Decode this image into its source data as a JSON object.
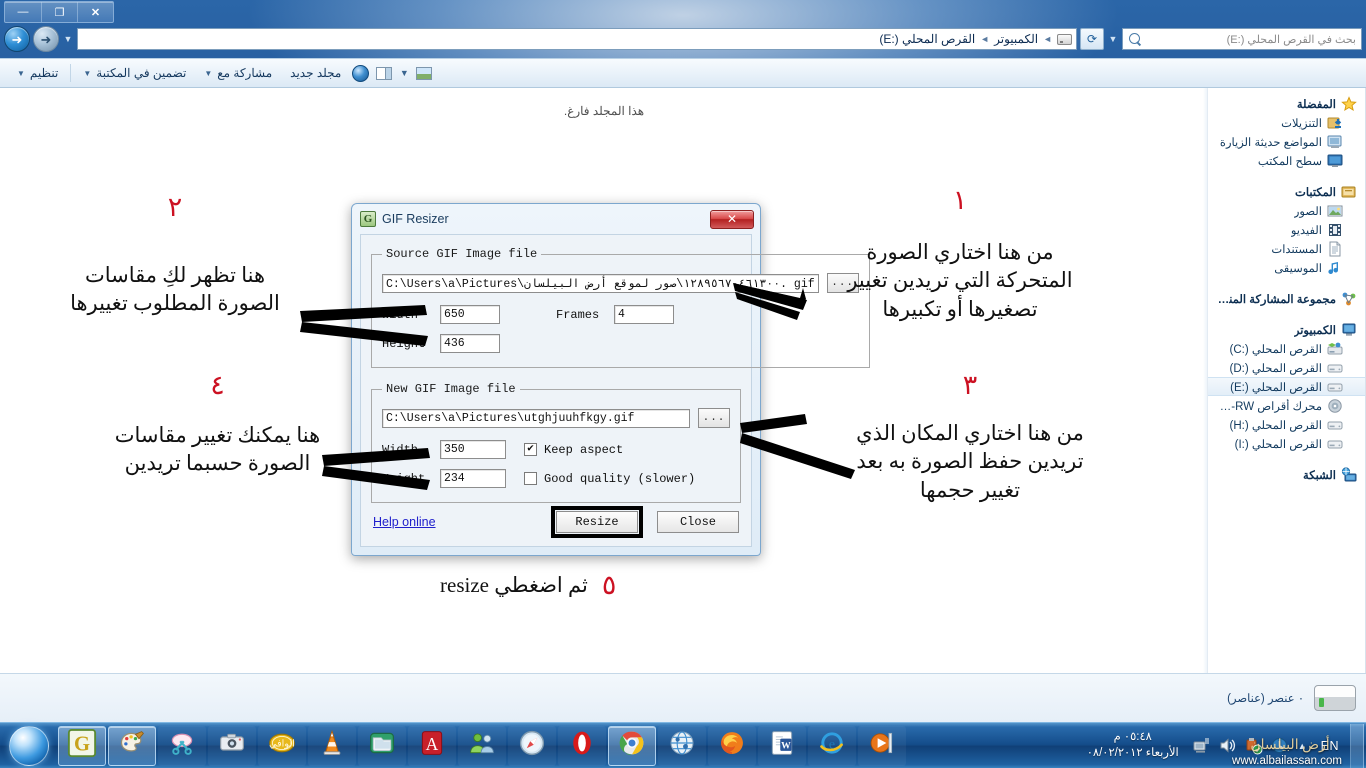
{
  "window": {
    "buttons": {
      "close": "✕",
      "restore": "❐",
      "minimize": "—"
    }
  },
  "address": {
    "back_icon": "back-arrow-icon",
    "forward_icon": "forward-arrow-icon",
    "crumb_computer": "الكمبيوتر",
    "crumb_drive": "القرص المحلي (:E)",
    "separator": "◄",
    "refresh_icon": "refresh-icon",
    "dropdown_icon": "chevron-down-icon"
  },
  "search": {
    "placeholder": "بحث في القرص المحلي (:E)",
    "icon": "search-icon"
  },
  "commandbar": {
    "organize": "تنظيم",
    "include_in_library": "تضمين في المكتبة",
    "share_with": "مشاركة مع",
    "new_folder": "مجلد جديد",
    "caret": "▼",
    "help_icon": "help-globe-icon",
    "layout_icon": "layout-pane-icon",
    "preview_icon": "preview-pane-icon"
  },
  "content": {
    "empty_message": "هذا المجلد فارغ."
  },
  "navpane": {
    "groups": [
      {
        "header": {
          "label": "المفضلة",
          "icon": "star-icon"
        },
        "items": [
          {
            "label": "التنزيلات",
            "icon": "downloads-icon"
          },
          {
            "label": "المواضع حديثة الزيارة",
            "icon": "recent-places-icon"
          },
          {
            "label": "سطح المكتب",
            "icon": "desktop-icon"
          }
        ]
      },
      {
        "header": {
          "label": "المكتبات",
          "icon": "libraries-icon"
        },
        "items": [
          {
            "label": "الصور",
            "icon": "pictures-icon"
          },
          {
            "label": "الفيديو",
            "icon": "videos-icon"
          },
          {
            "label": "المستندات",
            "icon": "documents-icon"
          },
          {
            "label": "الموسيقى",
            "icon": "music-icon"
          }
        ]
      },
      {
        "header": {
          "label": "مجموعة المشاركة المنزلية",
          "icon": "homegroup-icon"
        },
        "items": []
      },
      {
        "header": {
          "label": "الكمبيوتر",
          "icon": "computer-icon"
        },
        "items": [
          {
            "label": "القرص المحلي (:C)",
            "icon": "system-drive-icon",
            "selected": false
          },
          {
            "label": "القرص المحلي (:D)",
            "icon": "drive-icon",
            "selected": false
          },
          {
            "label": "القرص المحلي (:E)",
            "icon": "drive-icon",
            "selected": true
          },
          {
            "label": "محرك أقراص DVD-RW",
            "icon": "dvd-drive-icon",
            "selected": false
          },
          {
            "label": "القرص المحلي (:H)",
            "icon": "drive-icon",
            "selected": false
          },
          {
            "label": "القرص المحلي (:I)",
            "icon": "drive-icon",
            "selected": false
          }
        ]
      },
      {
        "header": {
          "label": "الشبكة",
          "icon": "network-icon"
        },
        "items": []
      }
    ]
  },
  "statusbar": {
    "item_count": "٠ عنصر (عناصر)",
    "icon": "hard-drive-icon"
  },
  "dialog": {
    "title": "GIF Resizer",
    "app_icon": "gif-resizer-icon",
    "close_button": "✕",
    "source_group": {
      "legend": "Source GIF Image file",
      "path_value": "C:\\Users\\a\\Pictures\\١٢٨٩٥٦٧٠٤٦١٣٠٠\\صور لموقع أرض البيلسان. gif",
      "browse_label": "...",
      "width_label": "Width",
      "width_value": "650",
      "height_label": "Height",
      "height_value": "436",
      "frames_label": "Frames",
      "frames_value": "4"
    },
    "new_group": {
      "legend": "New GIF Image file",
      "path_value": "C:\\Users\\a\\Pictures\\utghjuuhfkgy.gif",
      "browse_label": "...",
      "width_label": "Width",
      "width_value": "350",
      "height_label": "Height",
      "height_value": "234",
      "keep_aspect_label": "Keep aspect",
      "keep_aspect_checked": "✔",
      "good_quality_label": "Good quality (slower)",
      "good_quality_checked": ""
    },
    "help_link": "Help online",
    "resize_button": "Resize",
    "close_label": "Close"
  },
  "annotations": [
    {
      "number": "١",
      "text": "من هنا اختاري الصورة المتحركة التي تريدين تغيير تصغيرها أو تكبيرها"
    },
    {
      "number": "٢",
      "text": "هنا تظهر لكِ مقاسات الصورة المطلوب تغييرها"
    },
    {
      "number": "٣",
      "text": "من هنا اختاري المكان الذي تريدين حفظ الصورة به بعد تغيير حجمها"
    },
    {
      "number": "٤",
      "text": "هنا يمكنك تغيير مقاسات الصورة حسبما تريدين"
    },
    {
      "number": "٥",
      "text": "ثم اضغطي resize"
    }
  ],
  "taskbar": {
    "clock_time": "٠٥:٤٨ م",
    "clock_date": "الأربعاء ٠٨/٠٢/٢٠١٢",
    "language": "EN",
    "tray_caret": "▲",
    "tray_icons": [
      "network-icon",
      "volume-icon",
      "safely-remove-icon",
      "update-icon"
    ],
    "buttons": [
      {
        "name": "gif-resizer",
        "active": true
      },
      {
        "name": "paint",
        "active": true
      },
      {
        "name": "snipping-tool",
        "active": false
      },
      {
        "name": "camera-app",
        "active": false
      },
      {
        "name": "quran-app",
        "active": false
      },
      {
        "name": "vlc-media-player",
        "active": false
      },
      {
        "name": "folder-explorer",
        "active": false
      },
      {
        "name": "adobe-reader",
        "active": false
      },
      {
        "name": "messenger",
        "active": false
      },
      {
        "name": "safari",
        "active": false
      },
      {
        "name": "opera",
        "active": false
      },
      {
        "name": "google-chrome",
        "active": true
      },
      {
        "name": "internet-globe",
        "active": false
      },
      {
        "name": "mozilla-firefox",
        "active": false
      },
      {
        "name": "microsoft-word",
        "active": false
      },
      {
        "name": "internet-explorer",
        "active": false
      },
      {
        "name": "media-player",
        "active": false
      }
    ],
    "start_icon": "windows-start-orb",
    "watermark": "www.albailassan.com",
    "watermark_arabic": "أرض البيلسان"
  }
}
